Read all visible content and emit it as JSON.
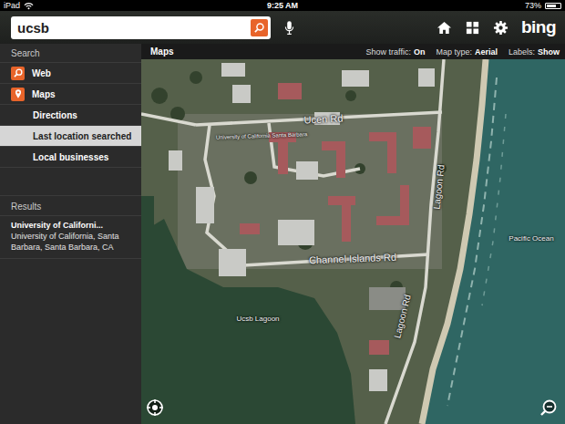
{
  "status_bar": {
    "device": "iPad",
    "time": "9:25 AM",
    "battery": "73%",
    "battery_level": 0.73
  },
  "search": {
    "value": "ucsb"
  },
  "top_bar": {
    "logo": "bing"
  },
  "sidebar": {
    "search_header": "Search",
    "items": [
      {
        "label": "Web",
        "kind": "icon",
        "selected": false
      },
      {
        "label": "Maps",
        "kind": "icon",
        "selected": false
      },
      {
        "label": "Directions",
        "kind": "plain",
        "selected": false
      },
      {
        "label": "Last location searched",
        "kind": "plain",
        "selected": true
      },
      {
        "label": "Local businesses",
        "kind": "plain",
        "selected": false
      }
    ],
    "results_header": "Results",
    "results": [
      {
        "title": "University of Californi...",
        "subtitle": "University of California, Santa Barbara, Santa Barbara, CA"
      }
    ]
  },
  "map": {
    "title": "Maps",
    "options": [
      {
        "label": "Show traffic:",
        "value": "On"
      },
      {
        "label": "Map type:",
        "value": "Aerial"
      },
      {
        "label": "Labels:",
        "value": "Show"
      }
    ],
    "labels": [
      {
        "text": "Ucen Rd"
      },
      {
        "text": "Lagoon Rd"
      },
      {
        "text": "Lagoon Rd"
      },
      {
        "text": "Channel Islands Rd"
      },
      {
        "text": "Ucsb Lagoon"
      },
      {
        "text": "Pacific Ocean"
      },
      {
        "text": "University of California Santa Barbara"
      }
    ]
  }
}
